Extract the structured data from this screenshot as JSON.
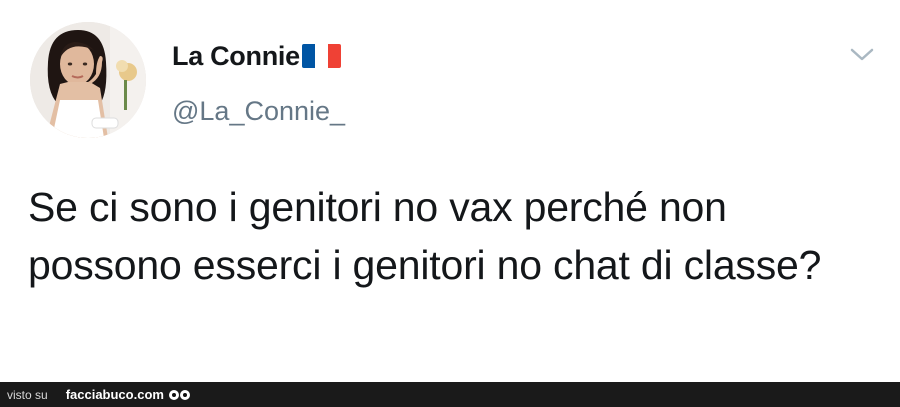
{
  "tweet": {
    "display_name": "La Connie",
    "flag": {
      "name": "france-flag",
      "colors": [
        "#0055A4",
        "#FFFFFF",
        "#EF4135"
      ]
    },
    "handle": "@La_Connie_",
    "text": "Se ci sono i genitori no vax perché non possono esserci i genitori no chat di classe?",
    "menu_icon": "chevron-down-icon"
  },
  "footer": {
    "visto_label": "visto su",
    "site_label": "facciabuco.com",
    "logo_icon": "eyes-icon"
  },
  "colors": {
    "name_text": "#14171a",
    "handle_text": "#657786",
    "chevron": "#aab8c2",
    "footer_bg": "#1a1a1a"
  }
}
